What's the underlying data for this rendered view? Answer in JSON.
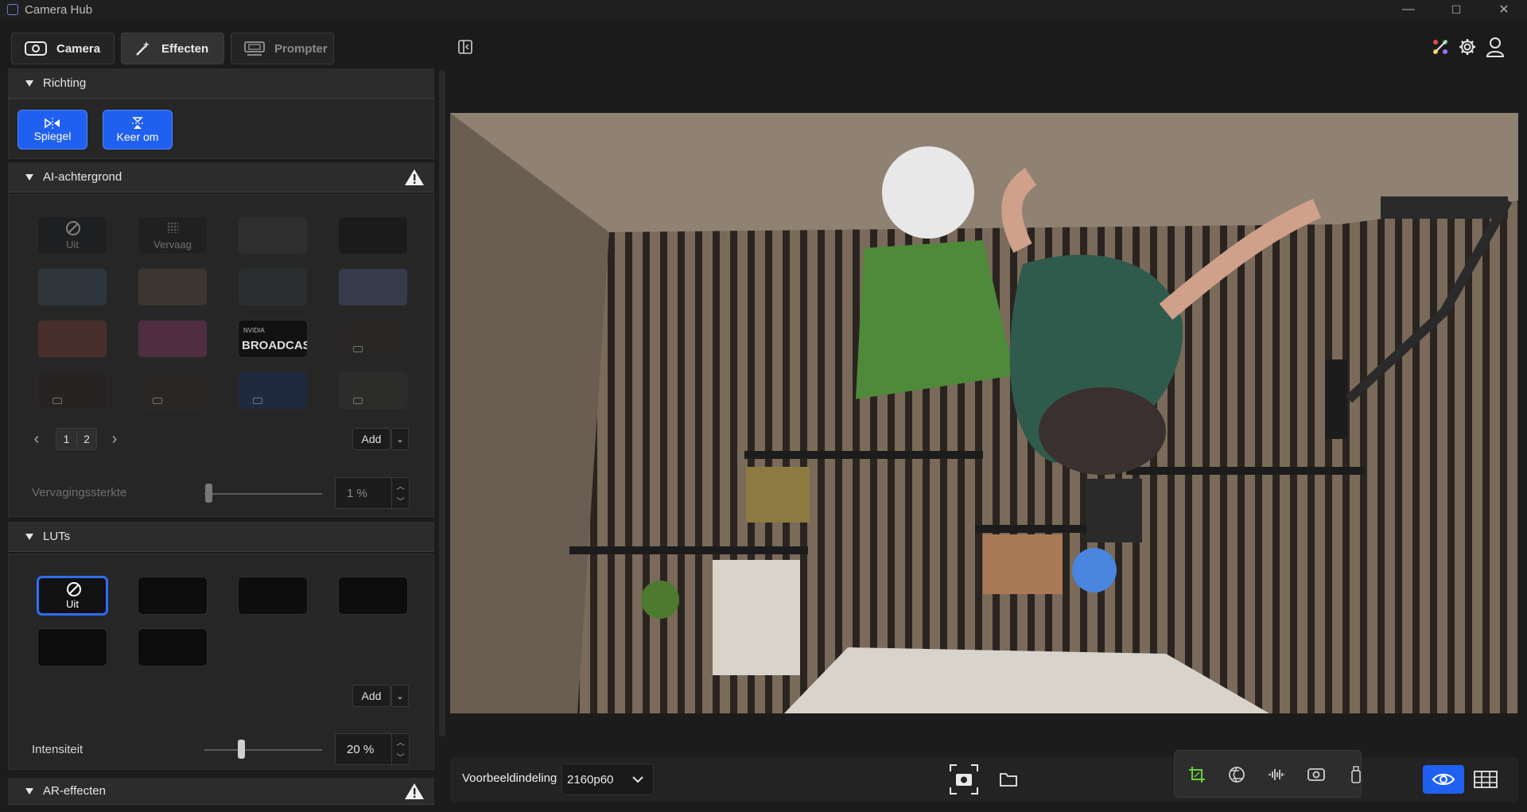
{
  "window": {
    "title": "Camera Hub",
    "controls": [
      "—",
      "☐",
      "✕"
    ]
  },
  "tabs": [
    {
      "label": "Camera",
      "icon": "camera-icon",
      "state": "normal"
    },
    {
      "label": "Effecten",
      "icon": "magic-wand-icon",
      "state": "active"
    },
    {
      "label": "Prompter",
      "icon": "prompter-icon",
      "state": "disabled"
    }
  ],
  "header_icons": [
    "nvidia-broadcast-icon",
    "gear-icon",
    "user-icon"
  ],
  "sections": {
    "richting": {
      "title": "Richting",
      "buttons": [
        {
          "label": "Spiegel",
          "icon": "mirror-icon"
        },
        {
          "label": "Keer om",
          "icon": "flip-vertical-icon"
        }
      ]
    },
    "ai_background": {
      "title": "AI-achtergrond",
      "warning_icon": "warning-icon",
      "tiles": [
        {
          "label": "Uit",
          "icon": "off-icon"
        },
        {
          "label": "Vervaag",
          "icon": "blur-icon"
        },
        {
          "label": ""
        },
        {
          "label": ""
        },
        {
          "label": ""
        },
        {
          "label": ""
        },
        {
          "label": ""
        },
        {
          "label": ""
        },
        {
          "label": ""
        },
        {
          "label": ""
        },
        {
          "label": "BROADCAST",
          "sublabel": "NVIDIA"
        },
        {
          "label": "",
          "icon": "video-icon"
        },
        {
          "label": "",
          "icon": "video-icon"
        },
        {
          "label": "",
          "icon": "video-icon"
        },
        {
          "label": "",
          "icon": "video-icon"
        },
        {
          "label": "",
          "icon": "video-icon"
        }
      ],
      "pager": {
        "prev": "‹",
        "pages": [
          "1",
          "2"
        ],
        "next": "›"
      },
      "add_label": "Add",
      "slider": {
        "label": "Vervagingssterkte",
        "value": "1 %",
        "level": 0.01
      }
    },
    "luts": {
      "title": "LUTs",
      "tiles": [
        {
          "label": "Uit",
          "icon": "off-icon",
          "selected": true
        },
        {
          "label": ""
        },
        {
          "label": ""
        },
        {
          "label": ""
        },
        {
          "label": ""
        },
        {
          "label": ""
        }
      ],
      "add_label": "Add",
      "slider": {
        "label": "Intensiteit",
        "value": "20 %",
        "level": 0.2
      }
    },
    "ar": {
      "title": "AR-effecten",
      "warning_icon": "warning-icon"
    }
  },
  "bottom": {
    "layout_label": "Voorbeeldindeling",
    "resolution": "2160p60",
    "actions": [
      "screenshot-icon",
      "folder-icon"
    ],
    "controls": [
      "crop-icon",
      "exposure-icon",
      "audio-icon",
      "camera-settings-icon",
      "usb-icon"
    ],
    "views": [
      "eye-icon",
      "grid-icon"
    ]
  },
  "colors": {
    "accent": "#2060f0",
    "panel": "#262626",
    "background": "#1c1c1c"
  }
}
